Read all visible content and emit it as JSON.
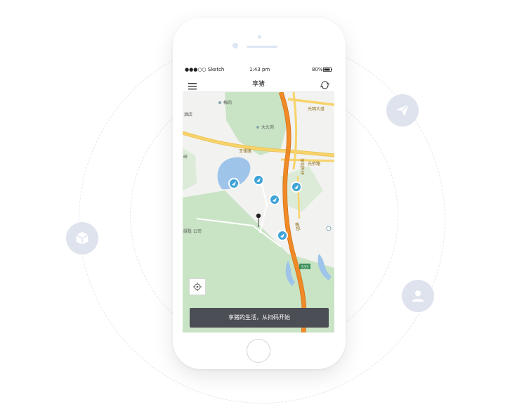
{
  "status": {
    "carrier": "●●●○○ Sketch",
    "time": "1:43 pm",
    "battery": "80%"
  },
  "nav": {
    "title": "享猪",
    "menu_icon": "hamburger-menu-icon",
    "right_icon": "refresh-icon"
  },
  "map": {
    "labels": {
      "place1": "梅岗",
      "place2": "大头岗",
      "hotel": "酒店",
      "road_guangming": "光明大道",
      "road_guangqiao": "光侨路",
      "road_yulv": "玉律路",
      "road_shenzhen": "深圳外环",
      "station": "粮田",
      "side_left": "研",
      "side_left2": "绿投 公司",
      "route_badge": "S33"
    },
    "colors": {
      "land": "#f2f2f0",
      "park": "#c9e4c5",
      "water": "#9ec4ea",
      "highway": "#f08a26",
      "main_road": "#f7d36a",
      "bike_pin": "#3fa3d8"
    }
  },
  "bottom_bar": {
    "text": "享猪的生活，从扫码开始"
  },
  "floating_icons": {
    "send": "paper-plane-icon",
    "box": "cube-icon",
    "user": "user-icon"
  }
}
